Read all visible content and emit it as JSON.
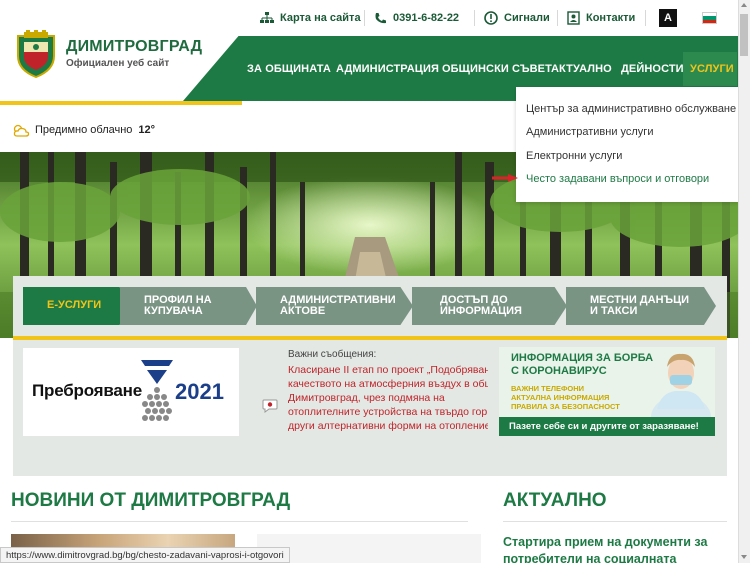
{
  "header": {
    "site_name": "ДИМИТРОВГРАД",
    "site_subtitle": "Официален уеб сайт",
    "topbar": {
      "sitemap": "Карта на сайта",
      "phone": "0391-6-82-22",
      "signals": "Сигнали",
      "contacts": "Контакти",
      "contrast": "A"
    },
    "nav": [
      "ЗА ОБЩИНАТА",
      "АДМИНИСТРАЦИЯ",
      "ОБЩИНСКИ СЪВЕТ",
      "АКТУАЛНО",
      "ДЕЙНОСТИ",
      "УСЛУГИ"
    ]
  },
  "dropdown": [
    "Център за административно обслужване",
    "Административни услуги",
    "Електронни услуги",
    "Често задавани въпроси и отговори"
  ],
  "weather": {
    "text": "Предимно облачно",
    "temp": "12°"
  },
  "tabs": [
    {
      "line1": "Е-УСЛУГИ",
      "line2": ""
    },
    {
      "line1": "ПРОФИЛ НА",
      "line2": "КУПУВАЧА"
    },
    {
      "line1": "АДМИНИСТРАТИВНИ",
      "line2": "АКТОВЕ"
    },
    {
      "line1": "ДОСТЪП ДО",
      "line2": "ИНФОРМАЦИЯ"
    },
    {
      "line1": "МЕСТНИ ДАНЪЦИ",
      "line2": "И ТАКСИ"
    }
  ],
  "census": {
    "text": "Преброяване",
    "year": "2021"
  },
  "news": {
    "header": "Важни съобщения:",
    "lines": [
      "Класиране II етап по проект „Подобряван",
      "качеството на атмосферния въздух в общ",
      "Димитровград, чрез подмяна на",
      "отоплителните устройства на твърдо гор",
      "други алтернативни форми на отопление"
    ]
  },
  "corona": {
    "title1": "ИНФОРМАЦИЯ ЗА БОРБА",
    "title2": "С КОРОНАВИРУС",
    "lines": [
      "ВАЖНИ ТЕЛЕФОНИ",
      "АКТУАЛНА ИНФОРМАЦИЯ",
      "ПРАВИЛА ЗА БЕЗОПАСНОСТ"
    ],
    "bottom": "Пазете себе си и другите от заразяване!"
  },
  "sections": {
    "news_title": "НОВИНИ ОТ ДИМИТРОВГРАД",
    "actual_title": "АКТУАЛНО",
    "actual_item_line1": "Стартира прием на документи за",
    "actual_item_line2": "потребители на социалната услуга"
  },
  "status_url": "https://www.dimitrovgrad.bg/bg/chesto-zadavani-vaprosi-i-otgovori",
  "colors": {
    "brand_green": "#1e7a45",
    "accent_yellow": "#f0c419",
    "alert_red": "#c0242a"
  }
}
